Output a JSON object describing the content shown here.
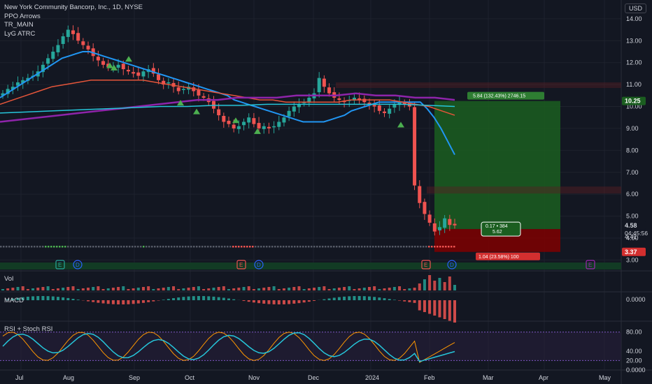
{
  "header": {
    "symbol_title": "New York Community Bancorp, Inc., 1D, NYSE",
    "indicators": [
      "PPO Arrows",
      "TR_MAIN",
      "LyG ATRC"
    ],
    "currency": "USD"
  },
  "price_axis": {
    "ticks": [
      "14.00",
      "13.00",
      "12.00",
      "11.00",
      "10.00",
      "9.00",
      "8.00",
      "7.00",
      "6.00",
      "5.00",
      "4.00",
      "3.00"
    ],
    "tag_target": "10.25",
    "tag_last": "4.58",
    "tag_countdown": "04:45:56",
    "tag_low": "4.41",
    "tag_stop": "3.37"
  },
  "time_axis": {
    "labels": [
      "Jul",
      "Aug",
      "Sep",
      "Oct",
      "Nov",
      "Dec",
      "2024",
      "Feb",
      "Mar",
      "Apr",
      "May"
    ]
  },
  "position_tool": {
    "target_label": "5.84 (132.43%) 2746.15",
    "center_line1": "0.17 • 384",
    "center_line2": "5.62",
    "stop_label": "1.04 (23.58%) 100"
  },
  "panes": {
    "volume": {
      "label": "Vol"
    },
    "macd": {
      "label": "MACD",
      "tick": "0.0000"
    },
    "rsi": {
      "label": "RSI + Stoch RSI",
      "ticks": [
        "80.00",
        "40.00",
        "20.00",
        "0.0000"
      ]
    }
  },
  "event_markers": [
    "E",
    "D",
    "E",
    "D",
    "E",
    "D",
    "E"
  ],
  "colors": {
    "background": "#131722",
    "up": "#26a69a",
    "down": "#ef5350",
    "ma_fast": "#2196f3",
    "ma_slow": "#e5553a",
    "ma_purple": "#8e24aa",
    "ma_cyan": "#26c6da",
    "target_zone": "#1b5e20",
    "stop_zone": "#7f0000",
    "arrow_up": "#4caf50",
    "rsi": "#26c6da",
    "stoch_k": "#ff9800"
  },
  "chart_data": {
    "type": "candlestick",
    "title": "New York Community Bancorp, Inc., 1D, NYSE",
    "x_labels": [
      "Jul",
      "Aug",
      "Sep",
      "Oct",
      "Nov",
      "Dec",
      "2024",
      "Feb",
      "Mar",
      "Apr",
      "May"
    ],
    "ylim": [
      2.6,
      14.6
    ],
    "closes": [
      10.6,
      10.8,
      10.9,
      11.1,
      11.2,
      11.3,
      11.4,
      11.6,
      11.9,
      12.2,
      12.5,
      12.8,
      13.2,
      13.5,
      13.3,
      13.0,
      12.8,
      12.6,
      12.3,
      12.1,
      11.9,
      11.8,
      11.8,
      11.9,
      11.7,
      11.6,
      11.5,
      11.4,
      11.6,
      11.7,
      11.5,
      11.2,
      11.0,
      11.1,
      10.9,
      10.7,
      10.8,
      10.9,
      10.7,
      10.5,
      10.4,
      10.2,
      9.9,
      9.6,
      9.3,
      9.2,
      9.0,
      9.1,
      9.3,
      9.5,
      9.2,
      9.0,
      9.1,
      9.0,
      9.1,
      9.3,
      9.5,
      9.8,
      10.0,
      10.1,
      10.2,
      10.4,
      10.6,
      11.3,
      10.9,
      10.6,
      10.4,
      10.3,
      10.2,
      10.3,
      10.4,
      10.3,
      10.2,
      10.1,
      10.0,
      9.8,
      9.7,
      9.9,
      10.1,
      10.2,
      10.1,
      10.0,
      6.4,
      5.6,
      5.1,
      4.7,
      4.3,
      4.5,
      4.9,
      4.6,
      4.58
    ],
    "series": [
      {
        "name": "MA fast",
        "values": [
          10.4,
          10.6,
          10.8,
          11.0,
          11.2,
          11.4,
          11.6,
          11.8,
          12.0,
          12.2,
          12.3,
          12.4,
          12.5,
          12.5,
          12.4,
          12.3,
          12.2,
          12.1,
          12.0,
          11.9,
          11.8,
          11.7,
          11.6,
          11.5,
          11.4,
          11.3,
          11.2,
          11.1,
          11.0,
          10.9,
          10.8,
          10.7,
          10.6,
          10.5,
          10.3,
          10.2,
          10.1,
          10.0,
          9.9,
          9.8,
          9.7,
          9.6,
          9.5,
          9.4,
          9.3,
          9.3,
          9.3,
          9.3,
          9.4,
          9.5,
          9.6,
          9.8,
          9.9,
          10.0,
          10.1,
          10.2,
          10.2,
          10.2,
          10.2,
          10.2,
          10.2,
          10.2,
          9.9,
          9.5,
          9.0,
          8.4,
          7.8
        ]
      },
      {
        "name": "MA slow",
        "values": [
          10.1,
          10.3,
          10.5,
          10.7,
          10.9,
          11.0,
          11.1,
          11.2,
          11.2,
          11.2,
          11.2,
          11.2,
          11.1,
          11.0,
          10.9,
          10.8,
          10.7,
          10.6,
          10.5,
          10.4,
          10.3,
          10.3,
          10.2,
          10.2,
          10.2,
          10.2,
          10.2,
          10.3,
          10.3,
          10.3,
          10.3,
          10.2,
          10.1,
          10.0,
          9.8,
          9.6
        ]
      },
      {
        "name": "MA purple",
        "values": [
          9.3,
          9.4,
          9.5,
          9.6,
          9.7,
          9.8,
          9.9,
          10.0,
          10.1,
          10.2,
          10.3,
          10.3,
          10.4,
          10.4,
          10.4,
          10.5,
          10.5,
          10.5,
          10.6,
          10.5,
          10.5,
          10.4,
          10.4,
          10.3
        ]
      },
      {
        "name": "MA cyan",
        "values": [
          9.7,
          9.75,
          9.8,
          9.85,
          9.9,
          9.95,
          10.0,
          10.0,
          10.05,
          10.05,
          10.1,
          10.1,
          10.1,
          10.1,
          10.1,
          10.1,
          10.05,
          10.0
        ]
      }
    ],
    "position": {
      "entry": 4.41,
      "target": 10.25,
      "stop": 3.37
    }
  }
}
